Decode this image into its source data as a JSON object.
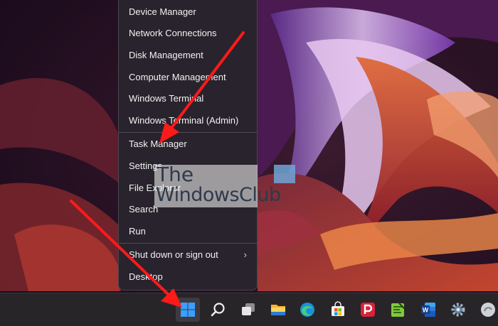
{
  "menu": {
    "items": [
      {
        "label": "Device Manager"
      },
      {
        "label": "Network Connections"
      },
      {
        "label": "Disk Management"
      },
      {
        "label": "Computer Management"
      },
      {
        "label": "Windows Terminal"
      },
      {
        "label": "Windows Terminal (Admin)"
      },
      {
        "label": "Task Manager"
      },
      {
        "label": "Settings"
      },
      {
        "label": "File Explorer"
      },
      {
        "label": "Search"
      },
      {
        "label": "Run"
      },
      {
        "label": "Shut down or sign out"
      },
      {
        "label": "Desktop"
      }
    ],
    "submenu_arrow": "›"
  },
  "watermark": {
    "line1": "The",
    "line2": "WindowsClub"
  },
  "taskbar": {
    "icons": [
      "windows-start-icon",
      "search-icon",
      "task-view-icon",
      "file-explorer-icon",
      "edge-icon",
      "microsoft-store-icon",
      "pocket-icon",
      "notepad-plus-plus-icon",
      "word-icon",
      "settings-gear-icon",
      "app-icon"
    ]
  },
  "colors": {
    "arrow": "#ff1a1a",
    "menu_bg": "#28242c",
    "taskbar_bg": "#282528",
    "accent": "#3aa0ff"
  }
}
